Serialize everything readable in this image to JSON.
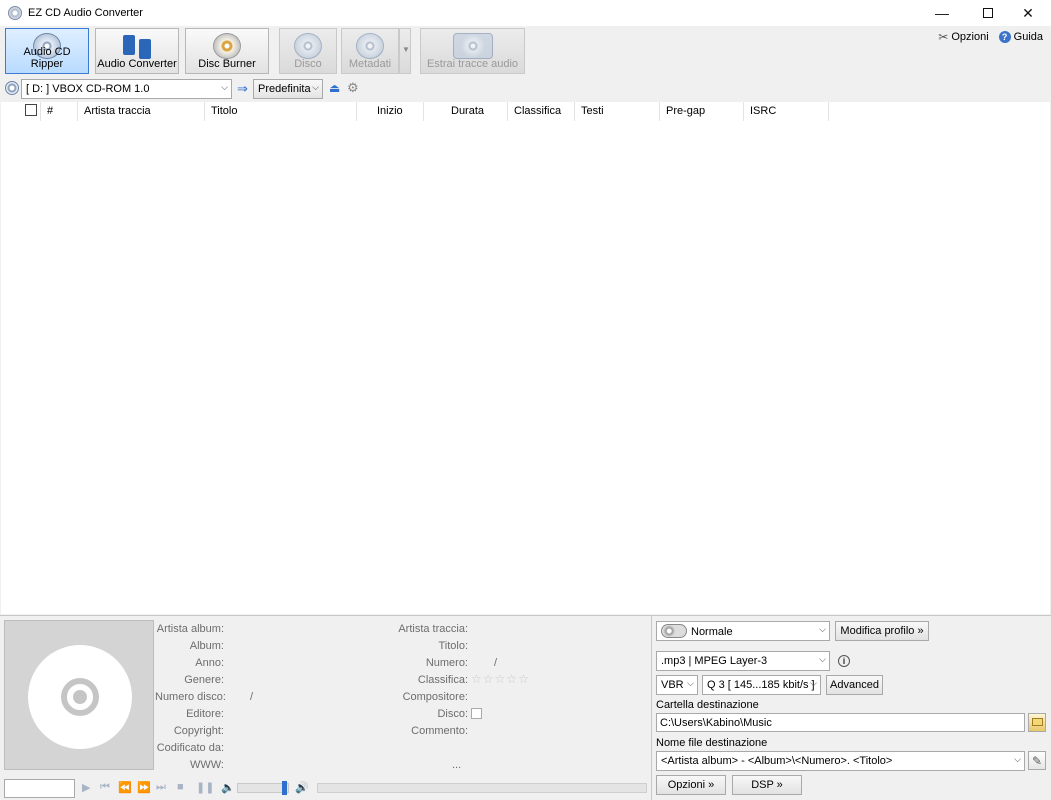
{
  "window": {
    "title": "EZ CD Audio Converter"
  },
  "toolbar": {
    "buttons": [
      {
        "label": "Audio CD Ripper",
        "active": true,
        "enabled": true
      },
      {
        "label": "Audio Converter",
        "active": false,
        "enabled": true
      },
      {
        "label": "Disc Burner",
        "active": false,
        "enabled": true
      },
      {
        "label": "Disco",
        "active": false,
        "enabled": false
      },
      {
        "label": "Metadati",
        "active": false,
        "enabled": false
      },
      {
        "label": "Estrai tracce audio",
        "active": false,
        "enabled": false
      }
    ],
    "options_label": "Opzioni",
    "help_label": "Guida"
  },
  "drive": {
    "selected": "[ D: ] VBOX CD-ROM 1.0",
    "profile": "Predefinita"
  },
  "tracklist": {
    "columns": [
      "#",
      "Artista traccia",
      "Titolo",
      "Inizio",
      "Durata",
      "Classifica",
      "Testi",
      "Pre-gap",
      "ISRC"
    ],
    "rows": []
  },
  "metadata": {
    "left_labels": [
      "Artista album:",
      "Album:",
      "Anno:",
      "Genere:",
      "Numero disco:",
      "Editore:",
      "Copyright:",
      "Codificato da:",
      "WWW:"
    ],
    "disc_number_separator": "/",
    "right_labels": [
      "Artista traccia:",
      "Titolo:",
      "Numero:",
      "Classifica:",
      "Compositore:",
      "Disco:",
      "Commento:"
    ],
    "track_number_separator": "/",
    "rating_stars": 5,
    "ellipsis": "..."
  },
  "encoder": {
    "profile": "Normale",
    "edit_profile_label": "Modifica profilo »",
    "format": ".mp3 | MPEG Layer-3",
    "mode": "VBR",
    "quality": "Q 3  [ 145...185 kbit/s ]",
    "advanced_label": "Advanced",
    "dest_folder_label": "Cartella destinazione",
    "dest_folder": "C:\\Users\\Kabino\\Music",
    "dest_filename_label": "Nome file destinazione",
    "dest_filename": "<Artista album> - <Album>\\<Numero>. <Titolo>",
    "options_label": "Opzioni »",
    "dsp_label": "DSP »"
  }
}
